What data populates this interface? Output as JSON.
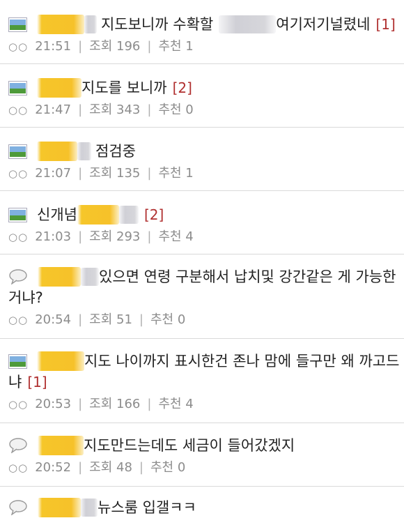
{
  "posts": [
    {
      "icon": "image-icon",
      "title": "지도보니까 수확할",
      "title_after": "여기저기널렸네",
      "reply": "[1]",
      "dots": "○○",
      "time": "21:51",
      "views_label": "조회",
      "views": "196",
      "rec_label": "추천",
      "rec": "1"
    },
    {
      "icon": "image-icon",
      "title": "지도를 보니까",
      "title_after": "",
      "reply": "[2]",
      "dots": "○○",
      "time": "21:47",
      "views_label": "조회",
      "views": "343",
      "rec_label": "추천",
      "rec": "0"
    },
    {
      "icon": "image-icon",
      "title": "점검중",
      "title_after": "",
      "reply": "",
      "dots": "○○",
      "time": "21:07",
      "views_label": "조회",
      "views": "135",
      "rec_label": "추천",
      "rec": "1"
    },
    {
      "icon": "image-icon",
      "title": "신개념",
      "title_after": "",
      "reply": "[2]",
      "dots": "○○",
      "time": "21:03",
      "views_label": "조회",
      "views": "293",
      "rec_label": "추천",
      "rec": "4"
    },
    {
      "icon": "speech-bubble-icon",
      "title": "있으면 연령 구분해서 납치및 강간같은 게 가능한",
      "title_line2": "거냐?",
      "reply": "",
      "dots": "○○",
      "time": "20:54",
      "views_label": "조회",
      "views": "51",
      "rec_label": "추천",
      "rec": "0"
    },
    {
      "icon": "image-icon",
      "title": "지도 나이까지 표시한건 존나 맘에 들구만 왜 까고드",
      "title_line2": "냐",
      "reply": "[1]",
      "dots": "○○",
      "time": "20:53",
      "views_label": "조회",
      "views": "166",
      "rec_label": "추천",
      "rec": "4"
    },
    {
      "icon": "speech-bubble-icon",
      "title": "지도만드는데도 세금이 들어갔겠지",
      "title_after": "",
      "reply": "",
      "dots": "○○",
      "time": "20:52",
      "views_label": "조회",
      "views": "48",
      "rec_label": "추천",
      "rec": "0"
    },
    {
      "icon": "speech-bubble-icon",
      "title": "뉴스룸 입갤ㅋㅋ",
      "title_after": "",
      "reply": "",
      "dots": "",
      "time": "",
      "views_label": "",
      "views": "",
      "rec_label": "",
      "rec": ""
    }
  ]
}
